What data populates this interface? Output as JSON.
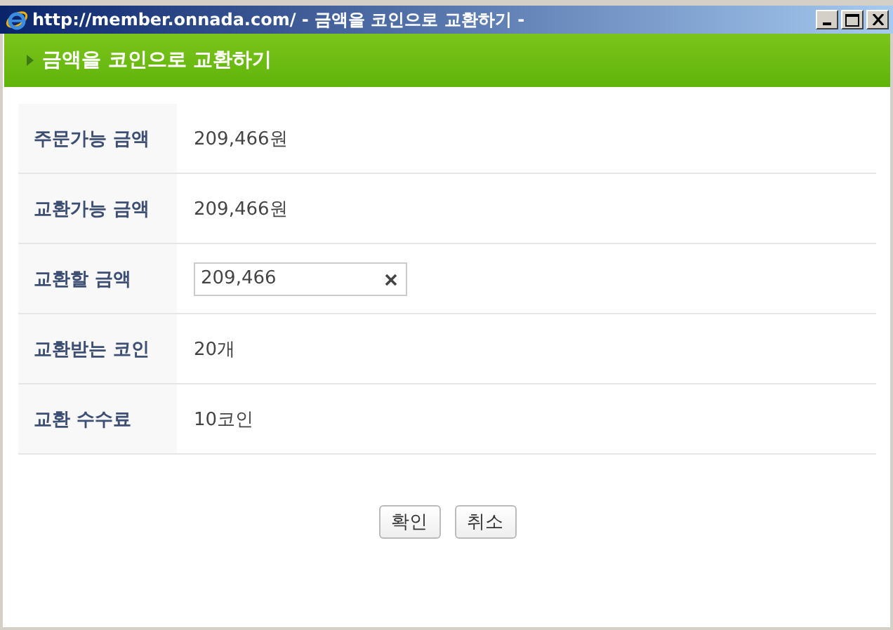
{
  "window": {
    "title": "http://member.onnada.com/ - 금액을 코인으로 교환하기 -"
  },
  "header": {
    "title": "금액을 코인으로 교환하기"
  },
  "rows": [
    {
      "kind": "text",
      "label": "주문가능 금액",
      "value": "209,466원"
    },
    {
      "kind": "text",
      "label": "교환가능 금액",
      "value": "209,466원"
    },
    {
      "kind": "input",
      "label": "교환할 금액",
      "value": "209,466"
    },
    {
      "kind": "text",
      "label": "교환받는 코인",
      "value": "20개"
    },
    {
      "kind": "text",
      "label": "교환 수수료",
      "value": "10코인"
    }
  ],
  "buttons": [
    "확인",
    "취소"
  ]
}
